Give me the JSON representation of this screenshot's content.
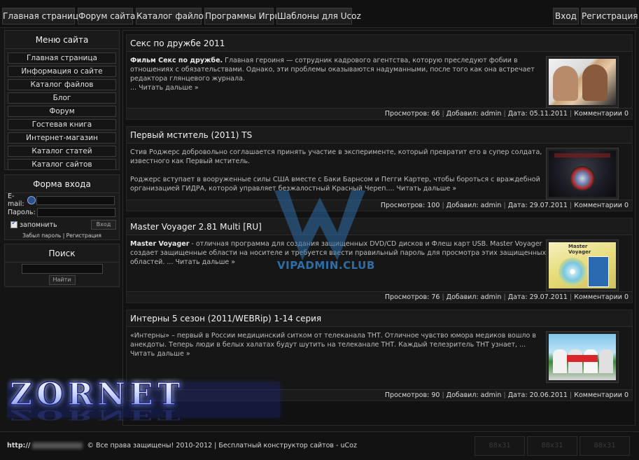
{
  "topnav": {
    "left": [
      "Главная страница",
      "Форум сайта",
      "Каталог файлов",
      "Программы Игры",
      "Шаблоны для Ucoz"
    ],
    "right": [
      "Вход",
      "Регистрация"
    ]
  },
  "sidebar": {
    "menu_title": "Меню сайта",
    "menu_items": [
      "Главная страница",
      "Информация о сайте",
      "Каталог файлов",
      "Блог",
      "Форум",
      "Гостевая книга",
      "Интернет-магазин",
      "Каталог статей",
      "Каталог сайтов"
    ],
    "login": {
      "title": "Форма входа",
      "email_label": "E-mail:",
      "password_label": "Пароль:",
      "remember_label": "запомнить",
      "login_button": "Вход",
      "forgot_link": "Забыл пароль",
      "divider": "|",
      "register_link": "Регистрация"
    },
    "search": {
      "title": "Поиск",
      "button": "Найти"
    }
  },
  "posts": [
    {
      "title": "Секс по дружбе 2011",
      "lead": "Фильм Секс по дружбе.",
      "text": " Главная героиня — сотрудник кадрового агентства, которую преследуют фобии в отношениях с обязательствами. Однако, эти проблемы оказываются надуманными, после того как она встречает редактора глянцевого журнала.",
      "more": "... Читать дальше »",
      "meta": {
        "views_label": "Просмотров:",
        "views": "66",
        "author_label": "Добавил:",
        "author": "admin",
        "date_label": "Дата:",
        "date": "05.11.2011",
        "comments_label": "Комментарии",
        "comments": "0"
      }
    },
    {
      "title": "Первый мститель (2011) TS",
      "lead": "",
      "text": "Стив Роджерс добровольно соглашается принять участие в эксперименте, который превратит его в супер солдата, известного как Первый мститель.",
      "text2": "Роджерс вступает в вооруженные силы США вместе с Баки Барнсом и Пегги Картер, чтобы бороться с враждебной организацией ГИДРА, которой управляет безжалостный Красный Череп...",
      "more": ". Читать дальше »",
      "meta": {
        "views_label": "Просмотров:",
        "views": "100",
        "author_label": "Добавил:",
        "author": "admin",
        "date_label": "Дата:",
        "date": "29.07.2011",
        "comments_label": "Комментарии",
        "comments": "0"
      }
    },
    {
      "title": "Master Voyager 2.81 Multi [RU]",
      "lead": "Master Voyager",
      "text": " - отличная программа для создания защищенных DVD/CD дисков и Флеш карт USB. Master Voyager создает защищенные области на носителе и требуется ввести правильный пароль для просмотра этих защищенных областей.",
      "more": "... Читать дальше »",
      "meta": {
        "views_label": "Просмотров:",
        "views": "76",
        "author_label": "Добавил:",
        "author": "admin",
        "date_label": "Дата:",
        "date": "29.07.2011",
        "comments_label": "Комментарии",
        "comments": "0"
      }
    },
    {
      "title": "Интерны 5 сезон (2011/WEBRip) 1-14 серия",
      "lead": "",
      "text": "«Интерны» – первый в России медицинский ситком от телеканала ТНТ. Отличное чувство юмора медиков вошло в анекдоты. Теперь люди в белых халатах будут шутить на телеканале ТНТ. Каждый телезритель ТНТ узнает,",
      "more": "... Читать дальше »",
      "meta": {
        "views_label": "Просмотров:",
        "views": "90",
        "author_label": "Добавил:",
        "author": "admin",
        "date_label": "Дата:",
        "date": "20.06.2011",
        "comments_label": "Комментарии",
        "comments": "0"
      }
    }
  ],
  "watermark": "VIPADMIN.CLUB",
  "logo_text": "ZORNET",
  "footer": {
    "prefix": "http://",
    "copyright": "© Все права защищены! 2010-2012 | Бесплатный",
    "builder_link": "конструктор сайтов",
    "suffix": "- uCoz",
    "counters": [
      "88x31",
      "88x31",
      "88x31"
    ]
  },
  "colors": {
    "background": "#141414",
    "accent_blue": "#2e6ea8",
    "text": "#cfcfcf"
  }
}
